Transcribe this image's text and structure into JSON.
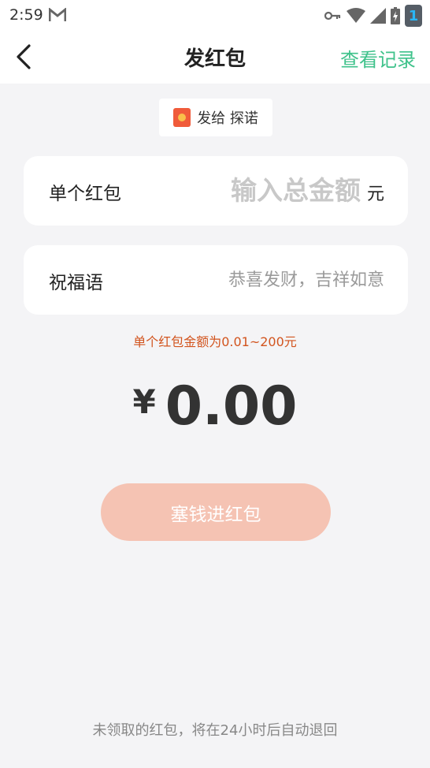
{
  "status_bar": {
    "time": "2:59",
    "notification_icon": "gmail-icon",
    "icons": [
      "vpn-key-icon",
      "wifi-icon",
      "signal-icon",
      "battery-charging-icon"
    ],
    "badge": "1"
  },
  "nav": {
    "back_icon": "chevron-left-icon",
    "title": "发红包",
    "action_label": "查看记录"
  },
  "recipient": {
    "icon": "red-envelope-icon",
    "text": "发给 探诺"
  },
  "amount_row": {
    "label": "单个红包",
    "placeholder": "输入总金额",
    "value": "",
    "unit": "元"
  },
  "greeting_row": {
    "label": "祝福语",
    "placeholder": "恭喜发财，吉祥如意",
    "value": ""
  },
  "hint": "单个红包金额为0.01~200元",
  "total": {
    "currency": "¥",
    "value": "0.00"
  },
  "submit_label": "塞钱进红包",
  "footer_note": "未领取的红包，将在24小时后自动退回",
  "colors": {
    "accent_green": "#3fc28b",
    "hint_orange": "#d2541e",
    "button_disabled": "#f5c3b3",
    "background": "#f4f4f6"
  }
}
